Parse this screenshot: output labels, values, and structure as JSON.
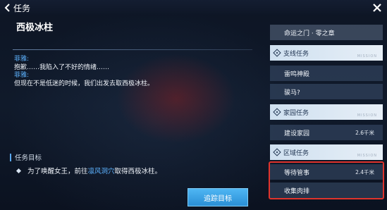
{
  "header": {
    "title": "任务"
  },
  "quest": {
    "title": "西极冰柱",
    "dialog": [
      {
        "speaker": "菲雅:",
        "text": "抱歉……我陷入了不好的情绪……"
      },
      {
        "speaker": "菲雅:",
        "text": "但现在不是低迷的时候，我们出发去取西极冰柱。"
      }
    ],
    "goal_heading": "任务目标",
    "goal": {
      "before": "为了唤醒女王，前往",
      "place": "凛风洞穴",
      "after": "取得西极冰柱。"
    },
    "track_button": "追踪目标"
  },
  "quest_list": {
    "chapter": "命运之门 · 零之章",
    "sections": [
      {
        "title": "支线任务",
        "watermark": "MISSION",
        "items": [
          {
            "name": "雷鸣神殿",
            "distance": ""
          },
          {
            "name": "骏马?",
            "distance": ""
          }
        ]
      },
      {
        "title": "家园任务",
        "watermark": "MISSION",
        "items": [
          {
            "name": "建设家园",
            "distance": "2.6千米"
          }
        ]
      },
      {
        "title": "区域任务",
        "watermark": "MISSION",
        "items": [
          {
            "name": "等待管事",
            "distance": "2.4千米"
          },
          {
            "name": "收集肉排",
            "distance": ""
          }
        ]
      }
    ]
  },
  "colors": {
    "accent_blue": "#5db3ff",
    "button": "#3aa2e6",
    "highlight": "#e0332c"
  },
  "icons": {
    "back": "back-arrow-icon",
    "close": "close-icon",
    "section": "section-diamond-icon",
    "goal": "goal-diamond-icon"
  }
}
